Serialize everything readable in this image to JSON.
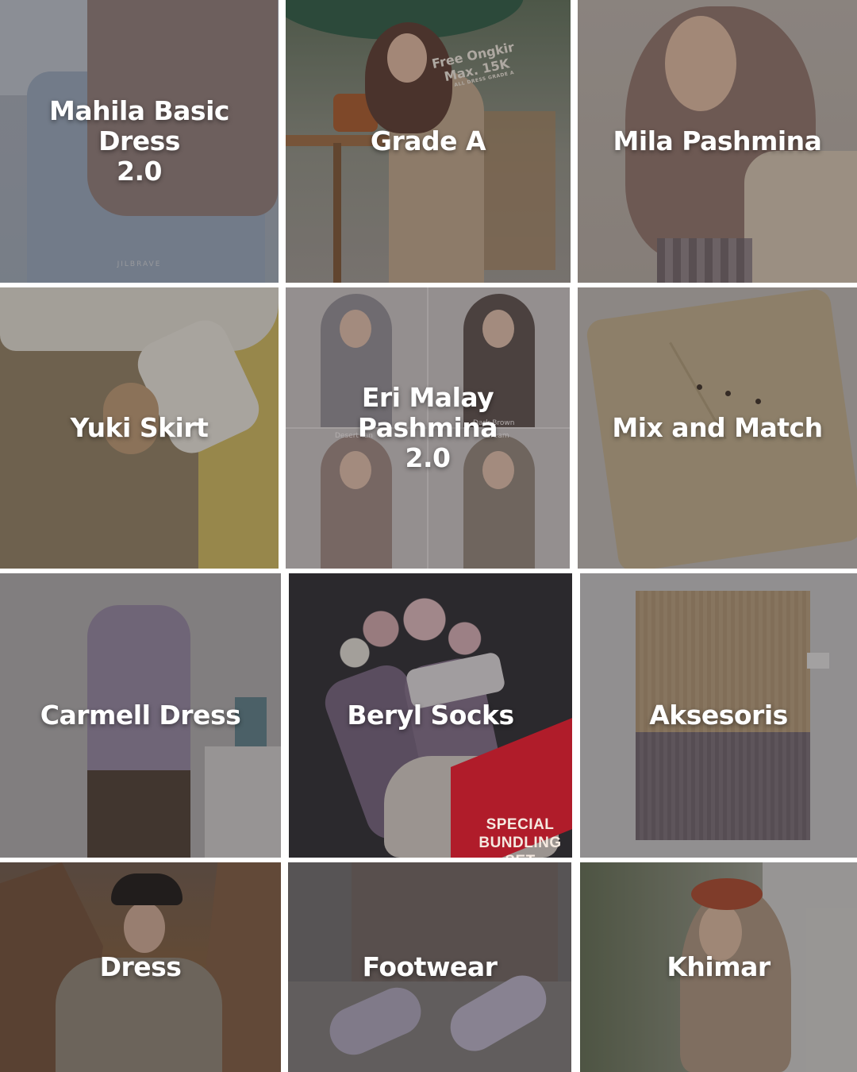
{
  "tiles": [
    {
      "label": "Mahila Basic Dress\n2.0",
      "watermark": "JILBRAVE"
    },
    {
      "label": "Grade A",
      "promo": {
        "line1": "Free Ongkir",
        "line2": "Max. 15K",
        "line3": "ALL DRESS GRADE A"
      }
    },
    {
      "label": "Mila Pashmina"
    },
    {
      "label": "Yuki Skirt"
    },
    {
      "label": "Eri Malay Pashmina\n2.0",
      "captions": [
        "Desert Tan",
        "Dark Brown",
        "Cream"
      ]
    },
    {
      "label": "Mix and Match"
    },
    {
      "label": "Carmell Dress"
    },
    {
      "label": "Beryl Socks",
      "badge": "SPECIAL\nBUNDLING SET"
    },
    {
      "label": "Aksesoris"
    },
    {
      "label": "Dress"
    },
    {
      "label": "Footwear"
    },
    {
      "label": "Khimar"
    }
  ],
  "colors": {
    "label_text": "#ffffff",
    "badge_red": "#b01c2a",
    "divider": "#ffffff"
  }
}
